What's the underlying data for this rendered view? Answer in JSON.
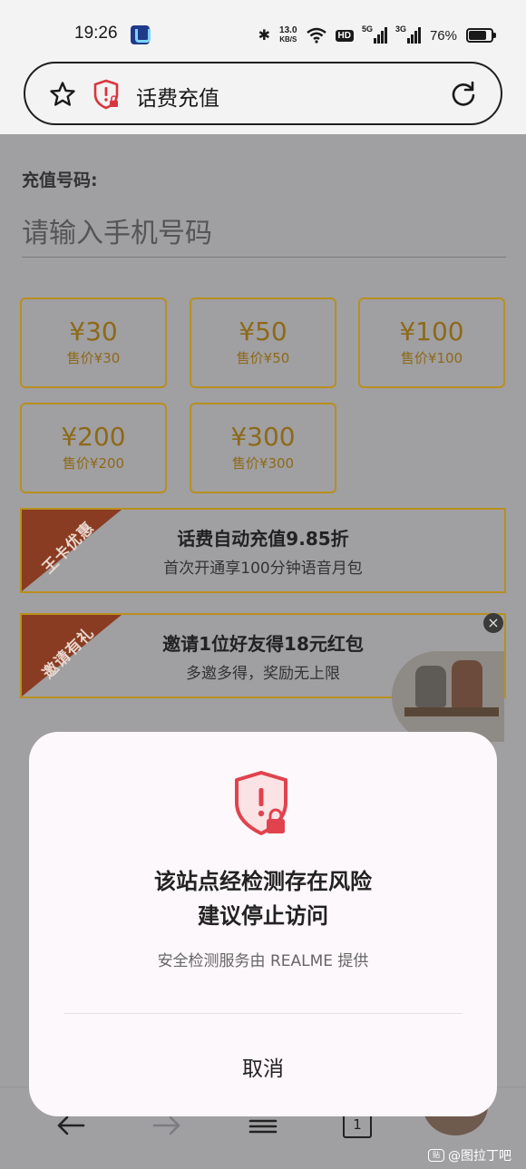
{
  "status_bar": {
    "time": "19:26",
    "bluetooth": "✱",
    "speed_value": "13.0",
    "speed_unit": "KB/S",
    "hd": "HD",
    "sim1": "5G",
    "sim2": "3G",
    "battery": "76%"
  },
  "url_bar": {
    "title": "话费充值"
  },
  "page": {
    "phone_label": "充值号码:",
    "phone_placeholder": "请输入手机号码",
    "options": [
      {
        "amount": "¥30",
        "sale": "售价¥30"
      },
      {
        "amount": "¥50",
        "sale": "售价¥50"
      },
      {
        "amount": "¥100",
        "sale": "售价¥100"
      },
      {
        "amount": "¥200",
        "sale": "售价¥200"
      },
      {
        "amount": "¥300",
        "sale": "售价¥300"
      }
    ],
    "promos": [
      {
        "ribbon": "王卡优惠",
        "main": "话费自动充值9.85折",
        "sub": "首次开通享100分钟语音月包"
      },
      {
        "ribbon": "邀请有礼",
        "main": "邀请1位好友得18元红包",
        "sub": "多邀多得，奖励无上限"
      }
    ],
    "close_glyph": "×"
  },
  "bottom_nav": {
    "tab_count": "1"
  },
  "dialog": {
    "title_line1": "该站点经检测存在风险",
    "title_line2": "建议停止访问",
    "subtitle": "安全检测服务由 REALME 提供",
    "cancel": "取消"
  },
  "watermark": {
    "icon_text": "贴",
    "text": "@图拉丁吧"
  },
  "colors": {
    "overlay": "#a09fa2",
    "gold": "#b8901f",
    "danger": "#e0434d",
    "dialog_bg": "#fdf8fb"
  }
}
